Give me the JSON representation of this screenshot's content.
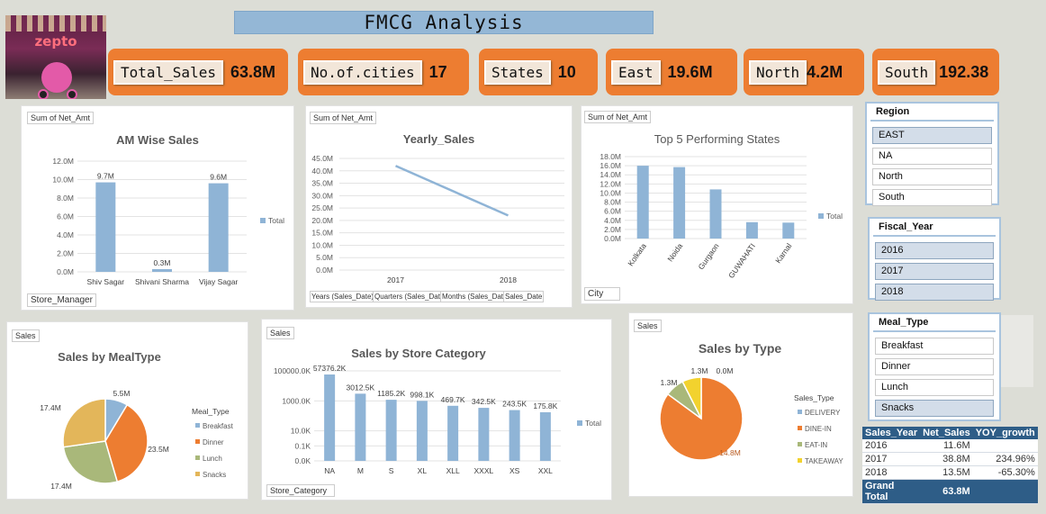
{
  "title": "FMCG Analysis",
  "logo": {
    "text": "zepto"
  },
  "kpis": [
    {
      "label": "Total_Sales",
      "value": "63.8M"
    },
    {
      "label": "No.of.cities",
      "value": "17"
    },
    {
      "label": "States",
      "value": "10"
    },
    {
      "label": "East",
      "value": "19.6M"
    },
    {
      "label": "North",
      "value": "4.2M"
    },
    {
      "label": "South",
      "value": "192.38"
    }
  ],
  "slicers": {
    "region": {
      "title": "Region",
      "items": [
        "EAST",
        "NA",
        "North",
        "South"
      ],
      "selected": [
        0
      ]
    },
    "fiscal_year": {
      "title": "Fiscal_Year",
      "items": [
        "2016",
        "2017",
        "2018"
      ],
      "selected": [
        0,
        1,
        2
      ]
    },
    "meal_type": {
      "title": "Meal_Type",
      "items": [
        "Breakfast",
        "Dinner",
        "Lunch",
        "Snacks"
      ],
      "selected": [
        3
      ]
    }
  },
  "pivot": {
    "headers": [
      "Sales_Year",
      "Net_Sales",
      "YOY_growth"
    ],
    "rows": [
      [
        "2016",
        "11.6M",
        ""
      ],
      [
        "2017",
        "38.8M",
        "234.96%"
      ],
      [
        "2018",
        "13.5M",
        "-65.30%"
      ]
    ],
    "total": [
      "Grand Total",
      "63.8M",
      ""
    ]
  },
  "accent_colors": {
    "kpi": "#ed7d31",
    "bar": "#8fb4d6",
    "title_bar": "#94b7d6"
  },
  "chart_data": [
    {
      "id": "am",
      "type": "bar",
      "tag": "Sum of Net_Amt",
      "title": "AM Wise Sales",
      "field_button": "Store_Manager",
      "categories": [
        "Shiv Sagar",
        "Shivani Sharma",
        "Vijay Sagar"
      ],
      "values": [
        9.7,
        0.3,
        9.6
      ],
      "data_labels": [
        "9.7M",
        "0.3M",
        "9.6M"
      ],
      "yticks": [
        "0.0M",
        "2.0M",
        "4.0M",
        "6.0M",
        "8.0M",
        "10.0M",
        "12.0M"
      ],
      "ylim": [
        0,
        12
      ],
      "legend": [
        "Total"
      ]
    },
    {
      "id": "yearly",
      "type": "line",
      "tag": "Sum of Net_Amt",
      "title": "Yearly_Sales",
      "field_buttons": [
        "Years (Sales_Date)",
        "Quarters (Sales_Date)",
        "Months (Sales_Date)",
        "Sales_Date"
      ],
      "x": [
        "2017",
        "2018"
      ],
      "values": [
        42.0,
        22.0
      ],
      "yticks": [
        "0.0M",
        "5.0M",
        "10.0M",
        "15.0M",
        "20.0M",
        "25.0M",
        "30.0M",
        "35.0M",
        "40.0M",
        "45.0M"
      ],
      "ylim": [
        0,
        45
      ]
    },
    {
      "id": "top5",
      "type": "bar",
      "tag": "Sum of Net_Amt",
      "title": "Top 5 Performing States",
      "field_button": "City",
      "categories": [
        "Kolkata",
        "Noida",
        "Gurgaon",
        "GUWAHATI",
        "Karnal"
      ],
      "values": [
        16.0,
        15.7,
        10.8,
        3.6,
        3.5
      ],
      "yticks": [
        "0.0M",
        "2.0M",
        "4.0M",
        "6.0M",
        "8.0M",
        "10.0M",
        "12.0M",
        "14.0M",
        "16.0M",
        "18.0M"
      ],
      "ylim": [
        0,
        18
      ],
      "legend": [
        "Total"
      ]
    },
    {
      "id": "meal",
      "type": "pie",
      "tag": "Sales",
      "title": "Sales by MealType",
      "legend_title": "Meal_Type",
      "labels": [
        "Breakfast",
        "Dinner",
        "Lunch",
        "Snacks"
      ],
      "values": [
        5.5,
        23.5,
        17.4,
        17.4
      ],
      "data_labels": [
        "5.5M",
        "23.5M",
        "17.4M",
        "17.4M"
      ],
      "colors": [
        "#8fb4d6",
        "#ed7d31",
        "#a9b87a",
        "#e3b65a"
      ]
    },
    {
      "id": "store",
      "type": "bar",
      "tag": "Sales",
      "title": "Sales by Store Category",
      "field_button": "Store_Category",
      "categories": [
        "NA",
        "M",
        "S",
        "XL",
        "XLL",
        "XXXL",
        "XS",
        "XXL"
      ],
      "values": [
        57376.2,
        3012.5,
        1185.2,
        998.1,
        469.7,
        342.5,
        243.5,
        175.8
      ],
      "data_labels": [
        "57376.2K",
        "3012.5K",
        "1185.2K",
        "998.1K",
        "469.7K",
        "342.5K",
        "243.5K",
        "175.8K"
      ],
      "yticks": [
        "0.0K",
        "0.1K",
        "10.0K",
        "1000.0K",
        "100000.0K"
      ],
      "y_scale": "log",
      "legend": [
        "Total"
      ]
    },
    {
      "id": "type",
      "type": "pie",
      "tag": "Sales",
      "title": "Sales by Type",
      "legend_title": "Sales_Type",
      "labels": [
        "DELIVERY",
        "DINE-IN",
        "EAT-IN",
        "TAKEAWAY"
      ],
      "values": [
        0.0,
        14.8,
        1.3,
        1.3
      ],
      "data_labels": [
        "0.0M",
        "14.8M",
        "1.3M",
        "1.3M"
      ],
      "colors": [
        "#8fb4d6",
        "#ed7d31",
        "#a9b87a",
        "#f2d22e"
      ]
    }
  ]
}
